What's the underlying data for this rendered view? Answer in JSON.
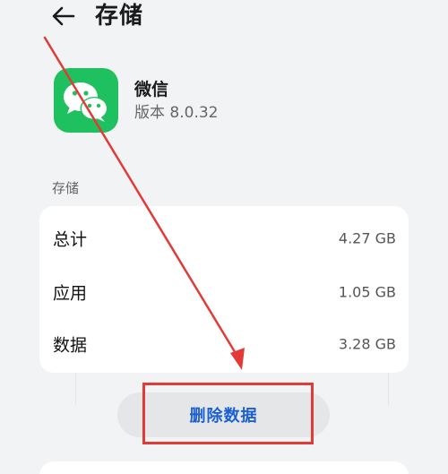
{
  "header": {
    "title": "存储",
    "back_icon": "arrow-left-icon"
  },
  "app": {
    "name": "微信",
    "version": "版本 8.0.32",
    "icon": "wechat-icon",
    "icon_color": "#1fc060"
  },
  "storage": {
    "section_label": "存储",
    "rows": [
      {
        "label": "总计",
        "value": "4.27 GB"
      },
      {
        "label": "应用",
        "value": "1.05 GB"
      },
      {
        "label": "数据",
        "value": "3.28 GB"
      }
    ]
  },
  "actions": {
    "delete_label": "删除数据",
    "delete_color": "#1b5fd0"
  },
  "annotation": {
    "color": "#e23a36"
  }
}
